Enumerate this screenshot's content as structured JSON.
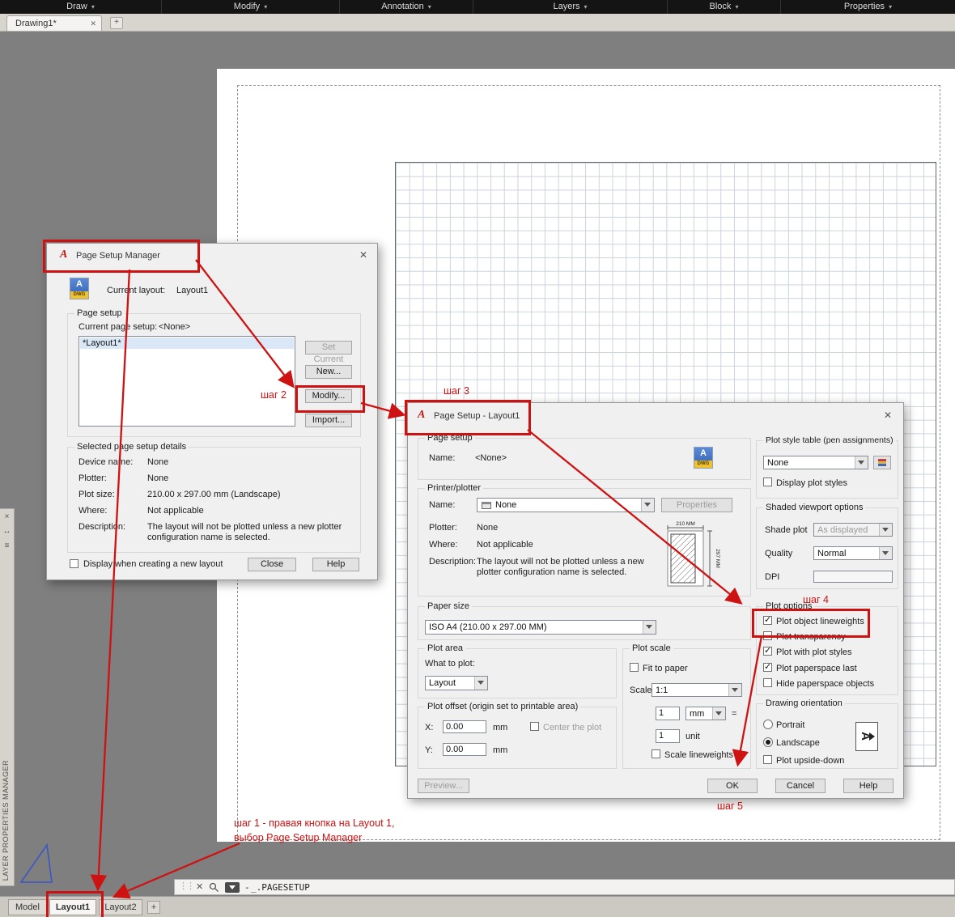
{
  "menubar": {
    "items": [
      {
        "label": "Draw"
      },
      {
        "label": "Modify"
      },
      {
        "label": "Annotation"
      },
      {
        "label": "Layers"
      },
      {
        "label": "Block"
      },
      {
        "label": "Properties"
      }
    ]
  },
  "file_tabs": {
    "active_tab": "Drawing1*"
  },
  "left_panel": {
    "title": "LAYER PROPERTIES MANAGER"
  },
  "icons": {
    "chevron": "▾",
    "close": "✕",
    "plus": "+",
    "autocad_a": "A",
    "dwg_letter": "A",
    "dwg_label": "DWG",
    "grip": "⋮⋮",
    "panel_close": "×",
    "panel_arrows": "↔",
    "panel_menu": "≡",
    "prompt_dash": "-",
    "orientation_letter": "A"
  },
  "psm": {
    "title": "Page Setup Manager",
    "current_layout_label": "Current layout:",
    "current_layout_value": "Layout1",
    "group_page_setup": "Page setup",
    "current_page_setup_label": "Current page setup:",
    "current_page_setup_value": "<None>",
    "layout_list_item": "*Layout1*",
    "btn_set_current": "Set Current",
    "btn_new": "New...",
    "btn_modify": "Modify...",
    "btn_import": "Import...",
    "group_details": "Selected page setup details",
    "details": [
      {
        "label": "Device name:",
        "value": "None"
      },
      {
        "label": "Plotter:",
        "value": "None"
      },
      {
        "label": "Plot size:",
        "value": "210.00 x 297.00 mm (Landscape)"
      },
      {
        "label": "Where:",
        "value": "Not applicable"
      },
      {
        "label": "Description:",
        "value": "The layout will not be plotted unless a new plotter configuration name is selected."
      }
    ],
    "display_checkbox_label": "Display when creating a new layout",
    "display_checkbox_checked": false,
    "btn_close": "Close",
    "btn_help": "Help"
  },
  "ps": {
    "title": "Page Setup - Layout1",
    "group_page_setup": "Page setup",
    "name_label": "Name:",
    "name_value": "<None>",
    "group_printer": "Printer/plotter",
    "printer_name_label": "Name:",
    "printer_name_value": "None",
    "btn_properties": "Properties",
    "plotter_label": "Plotter:",
    "plotter_value": "None",
    "where_label": "Where:",
    "where_value": "Not applicable",
    "description_label": "Description:",
    "description_value": "The layout will not be plotted unless a new plotter configuration name is selected.",
    "preview_width": "210 MM",
    "preview_height": "297 MM",
    "group_paper_size": "Paper size",
    "paper_size_value": "ISO A4 (210.00 x 297.00 MM)",
    "group_plot_area": "Plot area",
    "what_to_plot_label": "What to plot:",
    "what_to_plot_value": "Layout",
    "group_plot_offset": "Plot offset (origin set to printable area)",
    "x_label": "X:",
    "x_value": "0.00",
    "x_unit": "mm",
    "center_plot_label": "Center the plot",
    "center_plot_checked": false,
    "y_label": "Y:",
    "y_value": "0.00",
    "y_unit": "mm",
    "group_plot_scale": "Plot scale",
    "fit_to_paper_label": "Fit to paper",
    "fit_to_paper_checked": false,
    "scale_label": "Scale:",
    "scale_value": "1:1",
    "scale_num": "1",
    "scale_unit_value": "mm",
    "equals": "=",
    "scale_den": "1",
    "unit_label": "unit",
    "scale_lineweights_label": "Scale lineweights",
    "scale_lineweights_checked": false,
    "group_plot_style": "Plot style table (pen assignments)",
    "plot_style_value": "None",
    "display_plot_styles_label": "Display plot styles",
    "display_plot_styles_checked": false,
    "group_shaded": "Shaded viewport options",
    "shade_plot_label": "Shade plot",
    "shade_plot_value": "As displayed",
    "quality_label": "Quality",
    "quality_value": "Normal",
    "dpi_label": "DPI",
    "dpi_value": "",
    "group_plot_options": "Plot options",
    "plot_options": [
      {
        "label": "Plot object lineweights",
        "checked": true
      },
      {
        "label": "Plot transparency",
        "checked": false
      },
      {
        "label": "Plot with plot styles",
        "checked": true
      },
      {
        "label": "Plot paperspace last",
        "checked": true
      },
      {
        "label": "Hide paperspace objects",
        "checked": false
      }
    ],
    "group_orientation": "Drawing orientation",
    "portrait_label": "Portrait",
    "portrait_selected": false,
    "landscape_label": "Landscape",
    "landscape_selected": true,
    "upside_down_label": "Plot upside-down",
    "upside_down_checked": false,
    "btn_preview": "Preview...",
    "btn_ok": "OK",
    "btn_cancel": "Cancel",
    "btn_help": "Help"
  },
  "annotations": {
    "accent_color": "#ce1212",
    "step1_line1": "шаг 1 - правая кнопка на Layout 1,",
    "step1_line2": "выбор Page Setup Manager",
    "step2": "шаг 2",
    "step3": "шаг 3",
    "step4": "шаг 4",
    "step5": "шаг 5"
  },
  "statusbar": {
    "command_text": "_.PAGESETUP",
    "tabs": [
      {
        "label": "Model",
        "active": false
      },
      {
        "label": "Layout1",
        "active": true
      },
      {
        "label": "Layout2",
        "active": false
      }
    ]
  }
}
